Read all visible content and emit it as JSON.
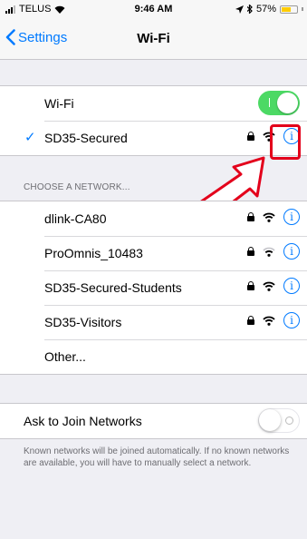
{
  "status_bar": {
    "carrier": "TELUS",
    "time": "9:46 AM",
    "battery": "57%"
  },
  "nav": {
    "back_label": "Settings",
    "title": "Wi-Fi"
  },
  "wifi": {
    "label": "Wi-Fi",
    "toggle_on": true
  },
  "connected": {
    "name": "SD35-Secured"
  },
  "networks_header": "CHOOSE A NETWORK...",
  "networks": [
    {
      "name": "dlink-CA80"
    },
    {
      "name": "ProOmnis_10483"
    },
    {
      "name": "SD35-Secured-Students"
    },
    {
      "name": "SD35-Visitors"
    }
  ],
  "other_label": "Other...",
  "ask_join": {
    "label": "Ask to Join Networks",
    "toggle_on": false
  },
  "footer_text": "Known networks will be joined automatically. If no known networks are available, you will have to manually select a network.",
  "colors": {
    "accent": "#007aff",
    "toggle_on": "#4cd964",
    "annotation": "#e3001b",
    "background": "#efeff4"
  },
  "icons": [
    "signal-icon",
    "wifi-icon",
    "location-icon",
    "bluetooth-icon",
    "battery-icon",
    "chevron-left-icon",
    "checkmark-icon",
    "lock-icon",
    "info-icon",
    "toggle-icon",
    "annotation-arrow-icon"
  ]
}
